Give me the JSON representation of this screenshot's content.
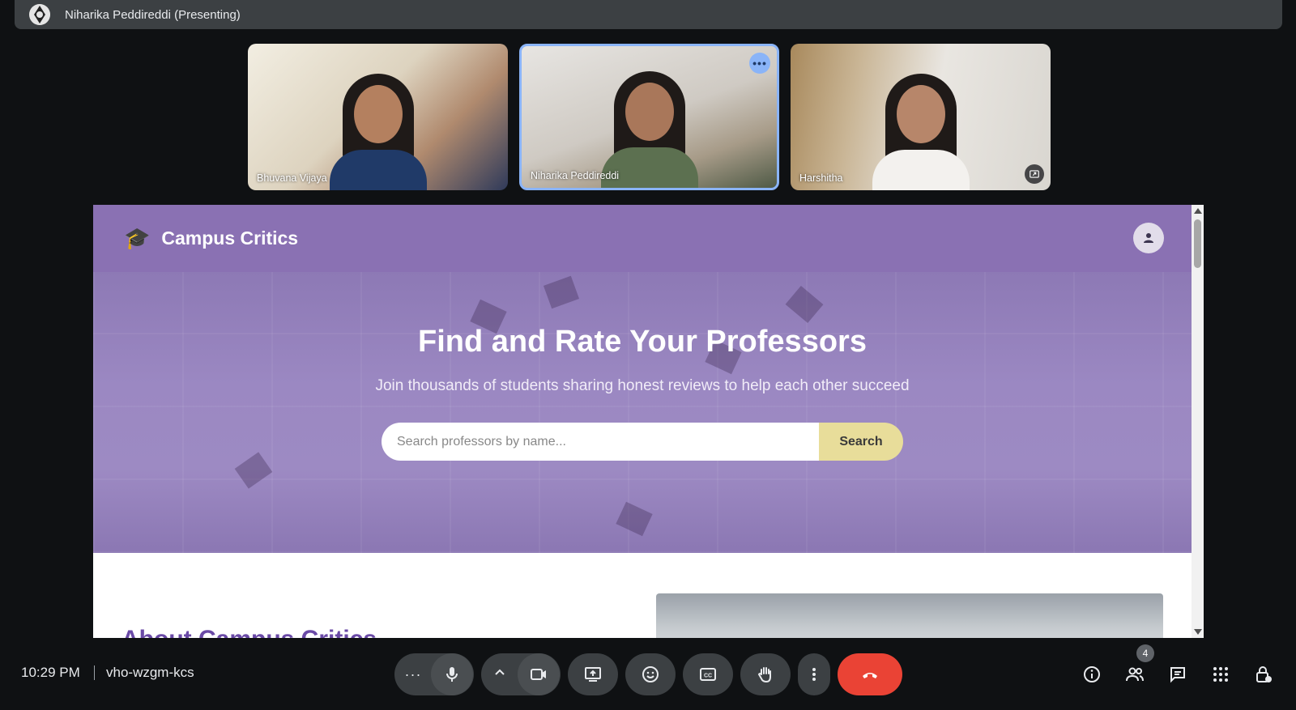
{
  "presenting": {
    "label": "Niharika Peddireddi (Presenting)"
  },
  "participants": [
    {
      "name": "Bhuvana Vijaya"
    },
    {
      "name": "Niharika Peddireddi"
    },
    {
      "name": "Harshitha"
    }
  ],
  "site": {
    "title": "Campus Critics",
    "hero_title": "Find and Rate Your Professors",
    "hero_subtitle": "Join thousands of students sharing honest reviews to help each other succeed",
    "search_placeholder": "Search professors by name...",
    "search_button": "Search",
    "about_title": "About Campus Critics"
  },
  "meeting": {
    "time": "10:29 PM",
    "code": "vho-wzgm-kcs",
    "participant_count": "4"
  },
  "colors": {
    "header": "#8a71b3",
    "search_button": "#e8dd9a",
    "end_call": "#ea4335",
    "active_speaker": "#8ab4f8"
  },
  "icons": {
    "more": "more-horiz-icon",
    "mic": "microphone-icon",
    "camera": "camera-icon",
    "present": "present-screen-icon",
    "emoji": "emoji-icon",
    "captions": "captions-icon",
    "hand": "raise-hand-icon",
    "end": "end-call-icon",
    "info": "info-icon",
    "people": "people-icon",
    "chat": "chat-icon",
    "activities": "apps-grid-icon",
    "host": "host-controls-icon"
  }
}
